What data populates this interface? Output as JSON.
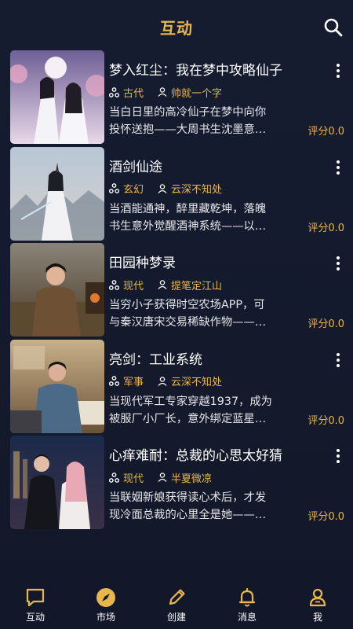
{
  "header": {
    "title": "互动"
  },
  "books": [
    {
      "title": "梦入红尘：我在梦中攻略仙子",
      "genre": "古代",
      "author": "帅就一个字",
      "desc1": "当白日里的高冷仙子在梦中向你",
      "desc2": "投怀送抱——大周书生沈墨意…",
      "rating": "评分0.0"
    },
    {
      "title": "酒剑仙途",
      "genre": "玄幻",
      "author": "云深不知处",
      "desc1": "当酒能通神，醉里藏乾坤，落魄",
      "desc2": "书生意外觉醒酒神系统——以…",
      "rating": "评分0.0"
    },
    {
      "title": "田园种梦录",
      "genre": "现代",
      "author": "提笔定江山",
      "desc1": "当穷小子获得时空农场APP，可",
      "desc2": "与秦汉唐宋交易稀缺作物——…",
      "rating": "评分0.0"
    },
    {
      "title": "亮剑：工业系统",
      "genre": "军事",
      "author": "云深不知处",
      "desc1": "当现代军工专家穿越1937，成为",
      "desc2": "被服厂小厂长，意外绑定蓝星…",
      "rating": "评分0.0"
    },
    {
      "title": "心痒难耐：总裁的心思太好猜",
      "genre": "现代",
      "author": "半夏微凉",
      "desc1": "当联姻新娘获得读心术后，才发",
      "desc2": "现冷面总裁的心里全是她——…",
      "rating": "评分0.0"
    }
  ],
  "nav": [
    {
      "label": "互动",
      "icon": "chat-bubble-icon"
    },
    {
      "label": "市场",
      "icon": "compass-icon",
      "active": true
    },
    {
      "label": "创建",
      "icon": "pencil-icon"
    },
    {
      "label": "消息",
      "icon": "bell-icon"
    },
    {
      "label": "我",
      "icon": "person-icon"
    }
  ],
  "colors": {
    "accent": "#e9b64c",
    "background": "#161c30",
    "text": "#ffffff"
  }
}
